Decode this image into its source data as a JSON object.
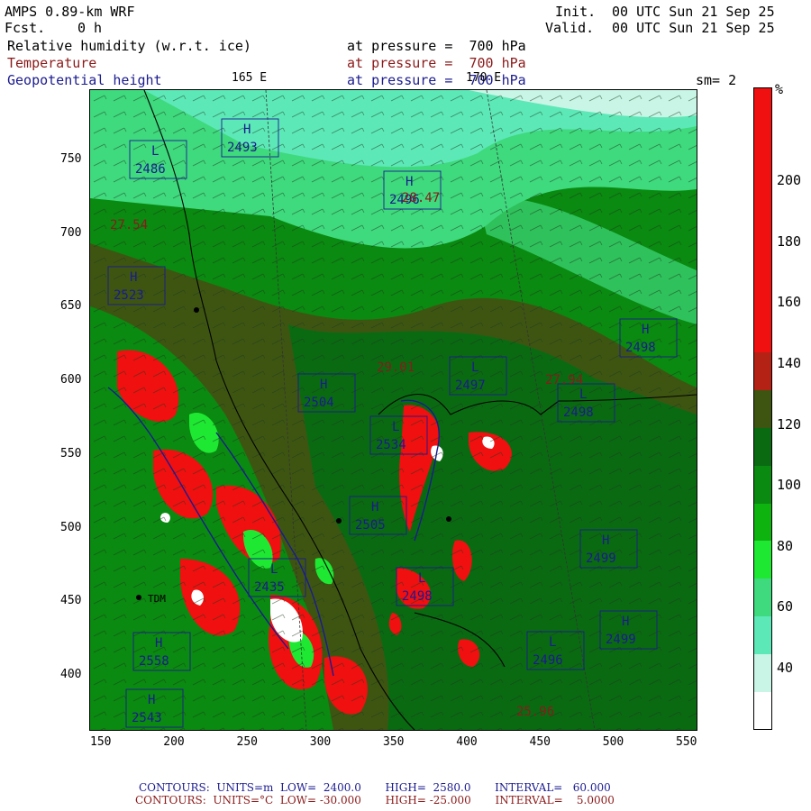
{
  "header": {
    "model": "AMPS 0.89-km WRF",
    "forecast_label": "Fcst.",
    "forecast_value": "0 h",
    "init_label": "Init.",
    "init_value": "00 UTC Sun 21 Sep 25",
    "valid_label": "Valid.",
    "valid_value": "00 UTC Sun 21 Sep 25",
    "smoothing": "sm= 2"
  },
  "fields": [
    {
      "name": "Relative humidity (w.r.t. ice)",
      "level": "at pressure =  700 hPa",
      "color": "#000000"
    },
    {
      "name": "Temperature",
      "level": "at pressure =  700 hPa",
      "color": "#8b1a1a"
    },
    {
      "name": "Geopotential height",
      "level": "at pressure =  700 hPa",
      "color": "#1b1b8f"
    }
  ],
  "meridian_labels": [
    "165 E",
    "170 E"
  ],
  "axes": {
    "x_ticks": [
      150,
      200,
      250,
      300,
      350,
      400,
      450,
      500,
      550
    ],
    "y_ticks": [
      400,
      450,
      500,
      550,
      600,
      650,
      700,
      750
    ]
  },
  "colorbar": {
    "unit": "%",
    "labels": [
      40,
      60,
      80,
      100,
      120,
      140,
      160,
      180,
      200
    ],
    "colors": [
      "#ffffff",
      "#c8f5e6",
      "#5de8b8",
      "#3fd97e",
      "#1ee832",
      "#0fb30f",
      "#0a8a10",
      "#0a6a12",
      "#3e5512",
      "#b32214",
      "#f01010",
      "#f01010",
      "#f01010",
      "#f01010",
      "#f01010",
      "#f01010",
      "#f01010"
    ]
  },
  "map_labels": {
    "highs": [
      {
        "letter": "H",
        "value": "2493"
      },
      {
        "letter": "H",
        "value": "2496"
      },
      {
        "letter": "H",
        "value": "2498"
      },
      {
        "letter": "H",
        "value": "2504"
      },
      {
        "letter": "H",
        "value": "2505"
      },
      {
        "letter": "H",
        "value": "2499"
      },
      {
        "letter": "H",
        "value": "2499"
      },
      {
        "letter": "H",
        "value": "2523"
      },
      {
        "letter": "H",
        "value": "2558"
      },
      {
        "letter": "H",
        "value": "2543"
      }
    ],
    "lows": [
      {
        "letter": "L",
        "value": "2486"
      },
      {
        "letter": "L",
        "value": "2497"
      },
      {
        "letter": "L",
        "value": "2498"
      },
      {
        "letter": "L",
        "value": "2496"
      },
      {
        "letter": "L",
        "value": "2498"
      },
      {
        "letter": "L",
        "value": "2534"
      },
      {
        "letter": "L",
        "value": "2435"
      }
    ],
    "temperatures": [
      "27.54",
      "28.47",
      "29.01",
      "27.94",
      "25.96"
    ],
    "station": "TDM"
  },
  "footer": {
    "height_contours": "CONTOURS:  UNITS=m  LOW=  2400.0       HIGH=  2580.0       INTERVAL=   60.000",
    "temp_contours": "CONTOURS:  UNITS=°C  LOW= -30.000       HIGH= -25.000       INTERVAL=    5.0000"
  }
}
